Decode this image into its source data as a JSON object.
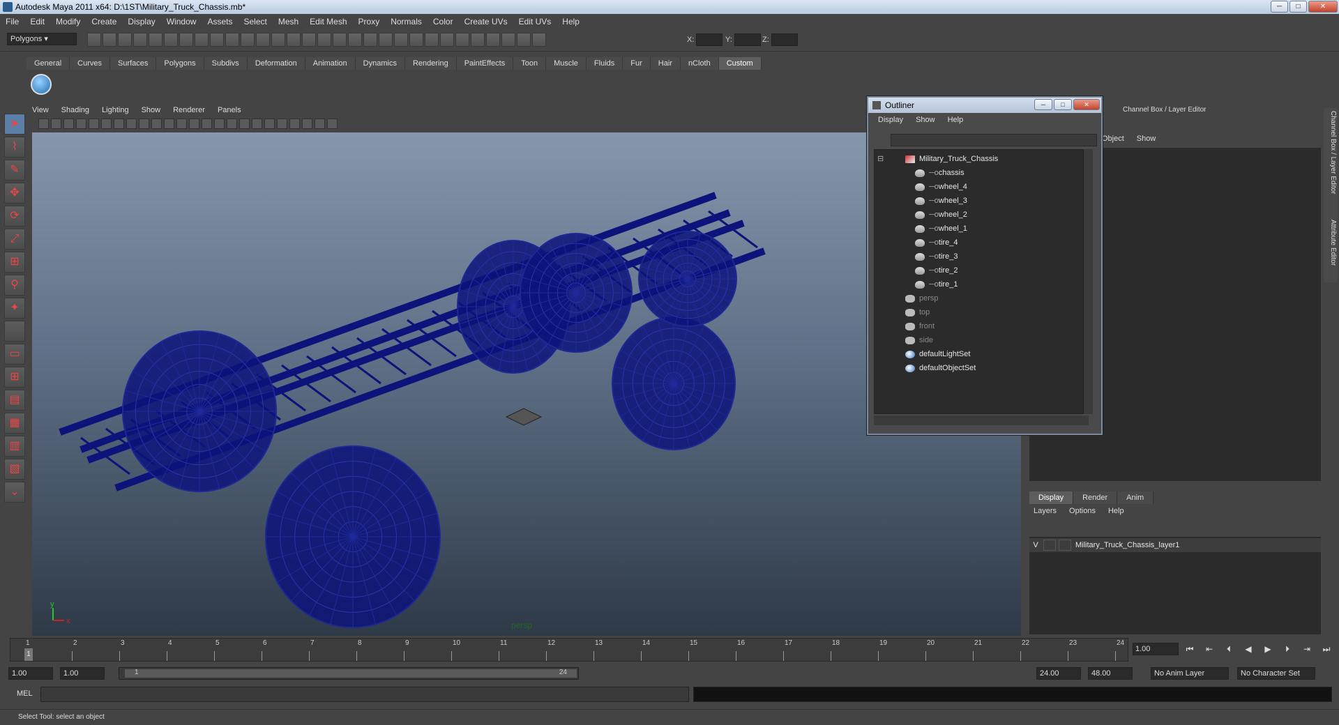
{
  "window": {
    "title": "Autodesk Maya 2011 x64: D:\\1ST\\Military_Truck_Chassis.mb*"
  },
  "menubar": [
    "File",
    "Edit",
    "Modify",
    "Create",
    "Display",
    "Window",
    "Assets",
    "Select",
    "Mesh",
    "Edit Mesh",
    "Proxy",
    "Normals",
    "Color",
    "Create UVs",
    "Edit UVs",
    "Help"
  ],
  "toolbar": {
    "mode": "Polygons",
    "x_label": "X:",
    "y_label": "Y:",
    "z_label": "Z:"
  },
  "shelf_tabs": [
    "General",
    "Curves",
    "Surfaces",
    "Polygons",
    "Subdivs",
    "Deformation",
    "Animation",
    "Dynamics",
    "Rendering",
    "PaintEffects",
    "Toon",
    "Muscle",
    "Fluids",
    "Fur",
    "Hair",
    "nCloth",
    "Custom"
  ],
  "shelf_active": "Custom",
  "viewport": {
    "menu": [
      "View",
      "Shading",
      "Lighting",
      "Show",
      "Renderer",
      "Panels"
    ],
    "camera_label": "persp",
    "axis_y": "y",
    "axis_x": "x",
    "wire_color": "#0c137a"
  },
  "outliner": {
    "title": "Outliner",
    "menu": [
      "Display",
      "Show",
      "Help"
    ],
    "items": [
      {
        "label": "Military_Truck_Chassis",
        "icon": "group-icon",
        "dim": false,
        "level": 0
      },
      {
        "label": "chassis",
        "icon": "mesh-icon",
        "dim": false,
        "level": 1
      },
      {
        "label": "wheel_4",
        "icon": "mesh-icon",
        "dim": false,
        "level": 1
      },
      {
        "label": "wheel_3",
        "icon": "mesh-icon",
        "dim": false,
        "level": 1
      },
      {
        "label": "wheel_2",
        "icon": "mesh-icon",
        "dim": false,
        "level": 1
      },
      {
        "label": "wheel_1",
        "icon": "mesh-icon",
        "dim": false,
        "level": 1
      },
      {
        "label": "tire_4",
        "icon": "mesh-icon",
        "dim": false,
        "level": 1
      },
      {
        "label": "tire_3",
        "icon": "mesh-icon",
        "dim": false,
        "level": 1
      },
      {
        "label": "tire_2",
        "icon": "mesh-icon",
        "dim": false,
        "level": 1
      },
      {
        "label": "tire_1",
        "icon": "mesh-icon",
        "dim": false,
        "level": 1
      },
      {
        "label": "persp",
        "icon": "camera-icon",
        "dim": true,
        "level": 0
      },
      {
        "label": "top",
        "icon": "camera-icon",
        "dim": true,
        "level": 0
      },
      {
        "label": "front",
        "icon": "camera-icon",
        "dim": true,
        "level": 0
      },
      {
        "label": "side",
        "icon": "camera-icon",
        "dim": true,
        "level": 0
      },
      {
        "label": "defaultLightSet",
        "icon": "set-icon",
        "dim": false,
        "level": 0
      },
      {
        "label": "defaultObjectSet",
        "icon": "set-icon",
        "dim": false,
        "level": 0
      }
    ]
  },
  "channel_box": {
    "title": "Channel Box / Layer Editor",
    "menu": [
      "Object",
      "Show"
    ]
  },
  "side_tabs": [
    "Channel Box / Layer Editor",
    "Attribute Editor"
  ],
  "layer_editor": {
    "tabs": [
      "Display",
      "Render",
      "Anim"
    ],
    "menu": [
      "Layers",
      "Options",
      "Help"
    ],
    "layers": [
      {
        "visible": "V",
        "name": "Military_Truck_Chassis_layer1"
      }
    ]
  },
  "time_slider": {
    "ticks": [
      "1",
      "2",
      "3",
      "4",
      "5",
      "6",
      "7",
      "8",
      "9",
      "10",
      "11",
      "12",
      "13",
      "14",
      "15",
      "16",
      "17",
      "18",
      "19",
      "20",
      "21",
      "22",
      "23",
      "24"
    ],
    "current_marker": "1",
    "current_frame": "1.00"
  },
  "range": {
    "start": "1.00",
    "playback_start": "1.00",
    "slider_start": "1",
    "slider_end": "24",
    "playback_end": "24.00",
    "end": "48.00",
    "anim_layer": "No Anim Layer",
    "character_set": "No Character Set"
  },
  "mel": {
    "label": "MEL"
  },
  "help_line": "Select Tool: select an object"
}
